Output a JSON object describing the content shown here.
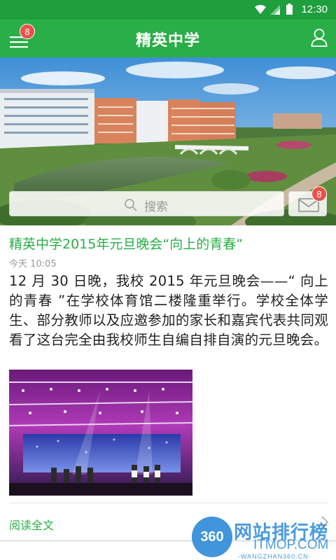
{
  "status_bar": {
    "time": "12:30"
  },
  "app_bar": {
    "title": "精英中学",
    "menu_badge": "8"
  },
  "hero": {
    "search_placeholder": "搜索",
    "mail_badge": "8"
  },
  "article": {
    "title": "精英中学2015年元旦晚会“向上的青春”",
    "time": "今天 10:05",
    "body": "12 月 30 日晚，我校 2015 年元旦晚会——“ 向上的青春 ”在学校体育馆二楼隆重举行。学校全体学生、部分教师以及应邀参加的家长和嘉宾代表共同观看了这台完全由我校师生自编自排自演的元旦晚会。",
    "read_more": "阅读全文"
  },
  "watermark": {
    "circle": "360",
    "line1": "网站排行榜",
    "line2": "ITMOP.COM",
    "line3": "-WANGZHAN360.CN-"
  },
  "colors": {
    "status_bar": "#1f9e3d",
    "app_bar": "#2aae48",
    "accent_green": "#2aae48",
    "badge_red": "#e8524a",
    "watermark_blue": "#2c8ad8"
  },
  "icons": {
    "menu": "hamburger-icon",
    "user": "user-icon",
    "search": "search-icon",
    "mail": "mail-icon",
    "more": "chevron-right-icon"
  }
}
